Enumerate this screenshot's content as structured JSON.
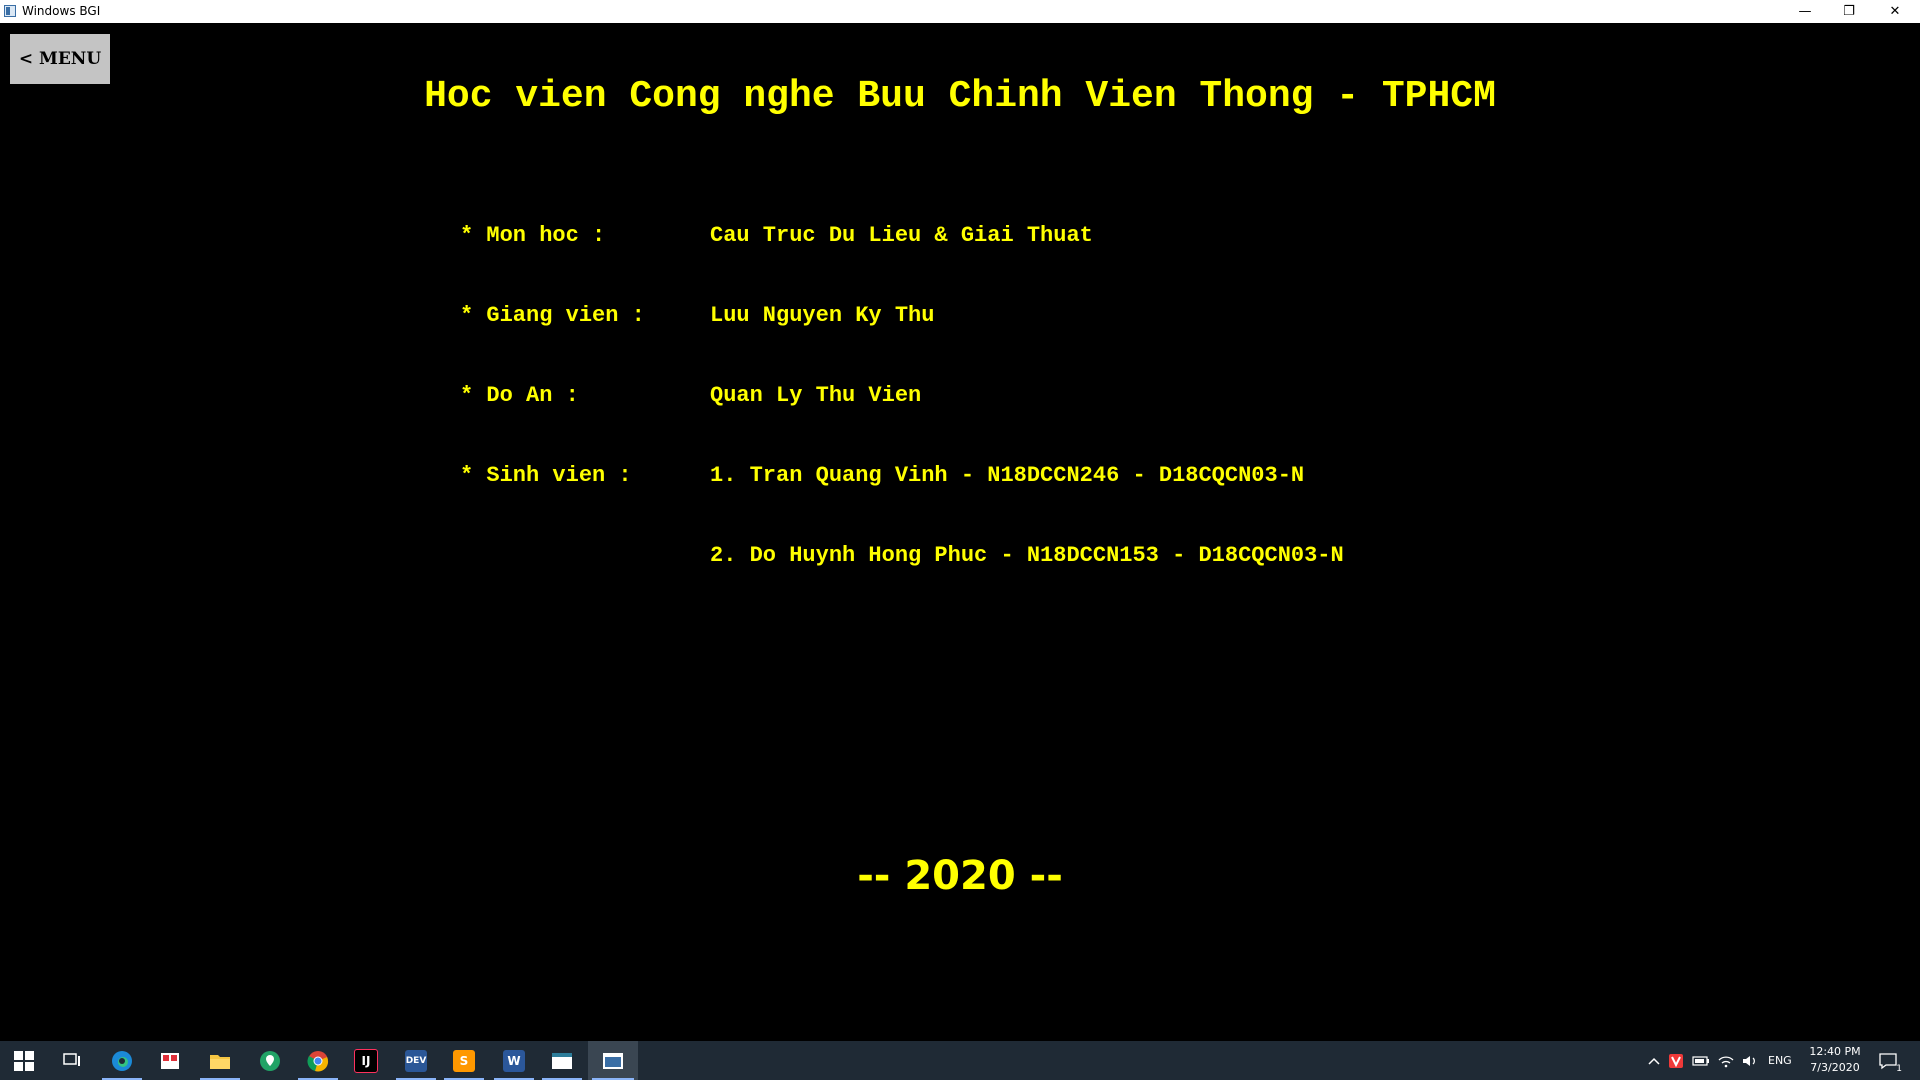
{
  "window": {
    "title": "Windows BGI",
    "controls": {
      "minimize": "—",
      "restore": "❐",
      "close": "✕"
    }
  },
  "app": {
    "menu_button": "< MENU",
    "heading": "Hoc vien Cong nghe Buu Chinh Vien Thong - TPHCM",
    "info": {
      "subject_label": "* Mon hoc :",
      "subject_value": "Cau Truc Du Lieu & Giai Thuat",
      "lecturer_label": "* Giang vien :",
      "lecturer_value": "Luu Nguyen Ky Thu",
      "project_label": "* Do An :",
      "project_value": "Quan Ly Thu Vien",
      "students_label": "* Sinh vien :",
      "students": [
        "1. Tran Quang Vinh - N18DCCN246 - D18CQCN03-N",
        "2. Do Huynh Hong Phuc - N18DCCN153 - D18CQCN03-N"
      ]
    },
    "year": "-- 2020 --",
    "text_color": "#ffff00",
    "background_color": "#000000"
  },
  "taskbar": {
    "apps": [
      {
        "icon": "windows-start-icon"
      },
      {
        "icon": "task-view-icon"
      },
      {
        "icon": "edge-icon"
      },
      {
        "icon": "snipping-tool-icon"
      },
      {
        "icon": "file-explorer-icon"
      },
      {
        "icon": "maps-icon"
      },
      {
        "icon": "chrome-icon"
      },
      {
        "icon": "intellij-icon",
        "label": "IJ"
      },
      {
        "icon": "dev-cpp-icon",
        "label": "DEV"
      },
      {
        "icon": "sublime-text-icon",
        "label": "S"
      },
      {
        "icon": "word-icon",
        "label": "W"
      },
      {
        "icon": "window-app-icon"
      },
      {
        "icon": "windows-bgi-icon"
      }
    ],
    "tray": {
      "language": "ENG",
      "time": "12:40 PM",
      "date": "7/3/2020",
      "notifications_count": "1"
    }
  }
}
